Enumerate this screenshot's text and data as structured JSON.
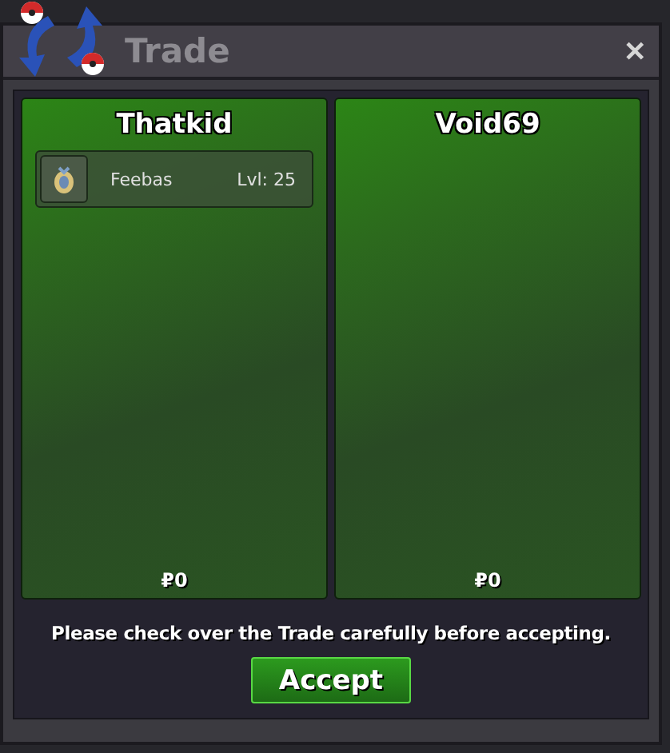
{
  "window": {
    "title": "Trade",
    "close": "✕"
  },
  "traders": [
    {
      "name": "Thatkid",
      "items": [
        {
          "name": "Feebas",
          "level": "Lvl: 25"
        }
      ],
      "money": "₽0"
    },
    {
      "name": "Void69",
      "money": "₽0"
    }
  ],
  "notice": "Please check over the Trade carefully before accepting.",
  "accept_button": "Accept"
}
